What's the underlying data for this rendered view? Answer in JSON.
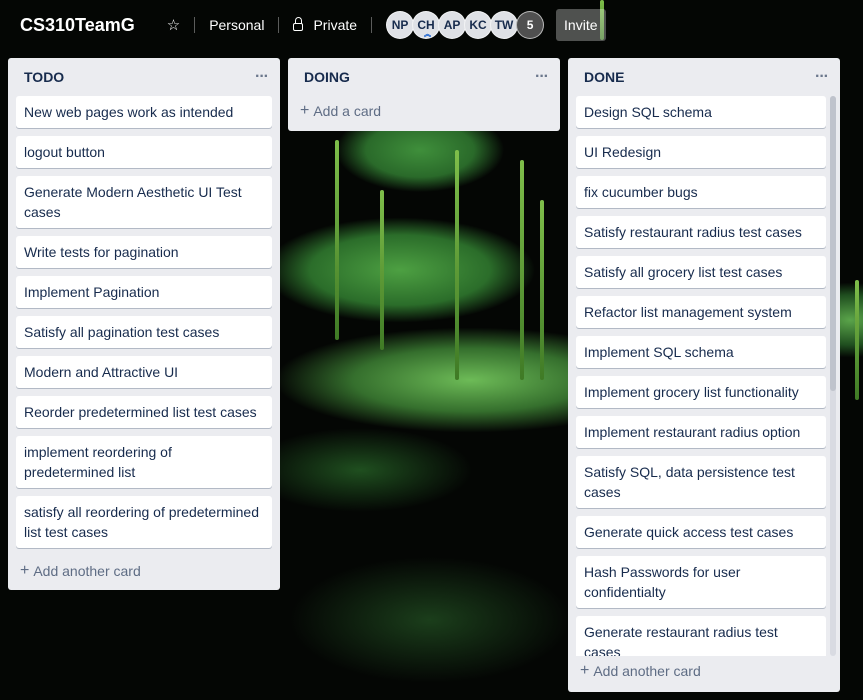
{
  "board": {
    "title": "CS310TeamG",
    "team_label": "Personal",
    "visibility_label": "Private",
    "invite_label": "Invite",
    "star_icon": "star-icon",
    "lock_icon": "lock-icon"
  },
  "members": [
    {
      "initials": "NP"
    },
    {
      "initials": "CH",
      "admin": true
    },
    {
      "initials": "AP"
    },
    {
      "initials": "KC"
    },
    {
      "initials": "TW"
    }
  ],
  "members_more": "5",
  "lists": {
    "todo": {
      "title": "TODO",
      "menu": "···",
      "add_label": "Add another card",
      "cards": [
        "New web pages work as intended",
        "logout button",
        "Generate Modern Aesthetic UI Test cases",
        "Write tests for pagination",
        "Implement Pagination",
        "Satisfy all pagination test cases",
        "Modern and Attractive UI",
        "Reorder predetermined list test cases",
        "implement reordering of predetermined list",
        "satisfy all reordering of predetermined list test cases"
      ]
    },
    "doing": {
      "title": "DOING",
      "menu": "···",
      "add_label": "Add a card",
      "cards": []
    },
    "done": {
      "title": "DONE",
      "menu": "···",
      "add_label": "Add another card",
      "cards": [
        "Design SQL schema",
        "UI Redesign",
        "fix cucumber bugs",
        "Satisfy restaurant radius test cases",
        "Satisfy all grocery list test cases",
        "Refactor list management system",
        "Implement SQL schema",
        "Implement grocery list functionality",
        "Implement restaurant radius option",
        "Satisfy SQL, data persistence test cases",
        "Generate quick access test cases",
        "Hash Passwords for user confidentialty",
        "Generate restaurant radius test cases"
      ]
    }
  }
}
